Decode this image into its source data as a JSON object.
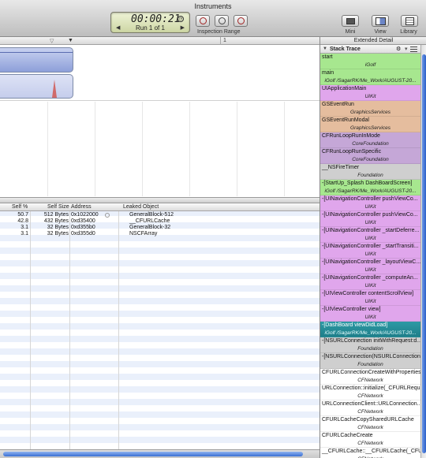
{
  "window": {
    "title": "Instruments"
  },
  "lcd": {
    "time": "00:00:21",
    "run": "Run 1 of 1",
    "prev": "◀",
    "next": "▶"
  },
  "inspection": {
    "label": "Inspection Range"
  },
  "toolbar": {
    "mini": "Mini",
    "view": "View",
    "library": "Library"
  },
  "ruler": {
    "marker_label": "1"
  },
  "table": {
    "columns": [
      "Self %",
      "Self Size",
      "Address",
      "Leaked Object"
    ],
    "rows": [
      {
        "self_pct": "50.7",
        "self_size": "512 Bytes",
        "address": "0x1022000",
        "object": "GeneralBlock-512"
      },
      {
        "self_pct": "42.8",
        "self_size": "432 Bytes",
        "address": "0xd35400",
        "object": "__CFURLCache"
      },
      {
        "self_pct": "3.1",
        "self_size": "32 Bytes",
        "address": "0xd355b0",
        "object": "GeneralBlock-32"
      },
      {
        "self_pct": "3.1",
        "self_size": "32 Bytes",
        "address": "0xd355d0",
        "object": "NSCFArray"
      }
    ]
  },
  "detail": {
    "title": "Extended Detail",
    "stack_trace_label": "Stack Trace",
    "frames": [
      {
        "symbol": "start",
        "library": "iGolf",
        "bg": "#a7e78f"
      },
      {
        "symbol": "main",
        "library": "iGolf /SagarRK/Me_Work/AUGUST-20...",
        "bg": "#a7e78f"
      },
      {
        "symbol": "UIApplicationMain",
        "library": "UIKit",
        "bg": "#e0a6ec"
      },
      {
        "symbol": "GSEventRun",
        "library": "GraphicsServices",
        "bg": "#e5bd9e"
      },
      {
        "symbol": "GSEventRunModal",
        "library": "GraphicsServices",
        "bg": "#e5bd9e"
      },
      {
        "symbol": "CFRunLoopRunInMode",
        "library": "CoreFoundation",
        "bg": "#c5a7d7"
      },
      {
        "symbol": "CFRunLoopRunSpecific",
        "library": "CoreFoundation",
        "bg": "#c5a7d7"
      },
      {
        "symbol": "__NSFireTimer",
        "library": "Foundation",
        "bg": "#cfcfcf"
      },
      {
        "symbol": "-[StartUp_Splash DashBoardScreen]",
        "library": "iGolf /SagarRK/Me_Work/AUGUST-20...",
        "bg": "#a7e78f"
      },
      {
        "symbol": "-[UINavigationController pushViewCo...",
        "library": "UIKit",
        "bg": "#e0a6ec"
      },
      {
        "symbol": "-[UINavigationController pushViewCo...",
        "library": "UIKit",
        "bg": "#e0a6ec"
      },
      {
        "symbol": "-[UINavigationController _startDeferre...",
        "library": "UIKit",
        "bg": "#e0a6ec"
      },
      {
        "symbol": "-[UINavigationController _startTransiti...",
        "library": "UIKit",
        "bg": "#e0a6ec"
      },
      {
        "symbol": "-[UINavigationController _layoutViewC...",
        "library": "UIKit",
        "bg": "#e0a6ec"
      },
      {
        "symbol": "-[UINavigationController _computeAn...",
        "library": "UIKit",
        "bg": "#e0a6ec"
      },
      {
        "symbol": "-[UIViewController contentScrollView]",
        "library": "UIKit",
        "bg": "#e0a6ec"
      },
      {
        "symbol": "-[UIViewController view]",
        "library": "UIKit",
        "bg": "#e0a6ec"
      },
      {
        "symbol": "-[DashBoard viewDidLoad]",
        "library": "iGolf /SagarRK/Me_Work/AUGUST-20...",
        "bg": "#2d9aa5",
        "selected": true
      },
      {
        "symbol": "-[NSURLConnection initWithRequest:d...",
        "library": "Foundation",
        "bg": "#cfcfcf"
      },
      {
        "symbol": "-[NSURLConnection(NSURLConnection...",
        "library": "Foundation",
        "bg": "#cfcfcf"
      },
      {
        "symbol": "CFURLConnectionCreateWithProperties",
        "library": "CFNetwork",
        "bg": "#ffffff"
      },
      {
        "symbol": "URLConnection::initialize(_CFURLRequ...",
        "library": "CFNetwork",
        "bg": "#ffffff"
      },
      {
        "symbol": "URLConnectionClient::URLConnection...",
        "library": "CFNetwork",
        "bg": "#ffffff"
      },
      {
        "symbol": "CFURLCacheCopySharedURLCache",
        "library": "CFNetwork",
        "bg": "#ffffff"
      },
      {
        "symbol": "CFURLCacheCreate",
        "library": "CFNetwork",
        "bg": "#ffffff"
      },
      {
        "symbol": "__CFURLCache::__CFURLCache(_CFUR...",
        "library": "CFNetwork",
        "bg": "#ffffff"
      }
    ]
  },
  "icons": {
    "gear": "gear-icon",
    "stack_triangle": "disclosure-triangle-icon"
  }
}
